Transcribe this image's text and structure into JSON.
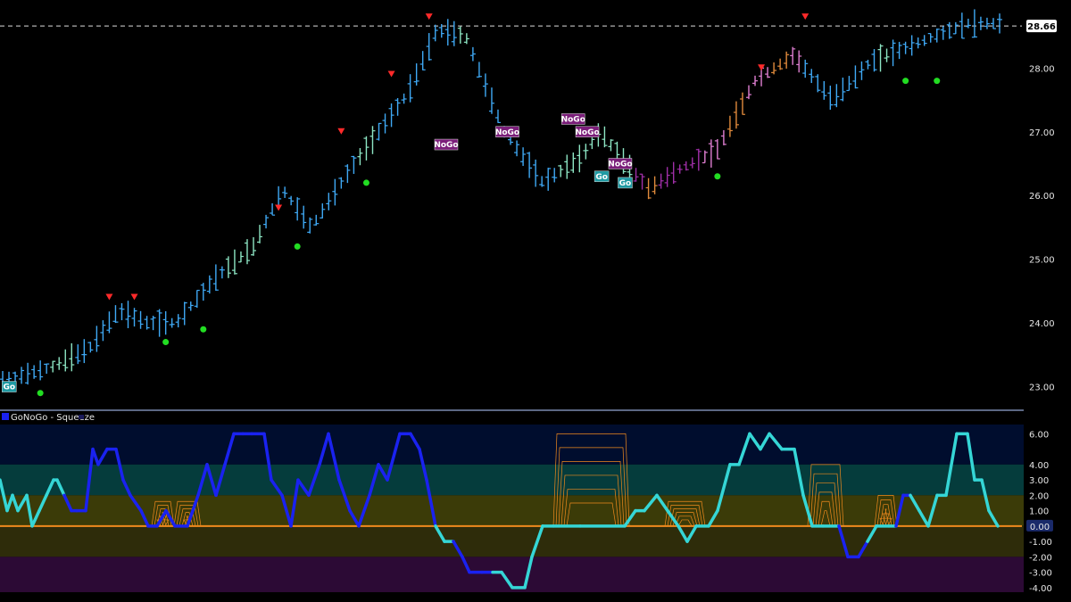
{
  "chart_data": [
    {
      "type": "ohlc",
      "price_axis": {
        "ticks": [
          "28.00",
          "27.00",
          "26.00",
          "25.00",
          "24.00",
          "23.00"
        ],
        "tick_values": [
          28,
          27,
          26,
          25,
          24,
          23
        ],
        "ylim": [
          22.7,
          28.9
        ]
      },
      "last_price_label": "28.66",
      "last_price": 28.66,
      "regime_labels": [
        {
          "text": "Go",
          "bar": 0,
          "price": 23.0
        },
        {
          "text": "NoGo",
          "bar": 92,
          "price": 26.8
        },
        {
          "text": "NoGo",
          "bar": 105,
          "price": 27.0
        },
        {
          "text": "NoGo",
          "bar": 119,
          "price": 27.2
        },
        {
          "text": "NoGo",
          "bar": 122,
          "price": 27.0
        },
        {
          "text": "NoGo",
          "bar": 129,
          "price": 26.5
        },
        {
          "text": "Go",
          "bar": 126,
          "price": 26.3
        },
        {
          "text": "Go",
          "bar": 131,
          "price": 26.2
        }
      ],
      "colors": {
        "strong_go": "#3fa9f5",
        "weak_go": "#8de6c4",
        "weak_nogo": "#e07fd2",
        "strong_nogo": "#a02fa8",
        "amber": "#e08a3c",
        "go_tag": "#1f9aa3",
        "nogo_tag": "#7b1e7a",
        "down_marker": "#ff2a2a",
        "up_marker": "#22dd22"
      }
    },
    {
      "type": "line",
      "title": "GoNoGo - Squeeze",
      "oscillator_axis": {
        "ticks": [
          "6.00",
          "4.00",
          "3.00",
          "2.00",
          "1.00",
          "0.00",
          "-1.00",
          "-2.00",
          "-3.00",
          "-4.00"
        ],
        "tick_values": [
          6,
          4,
          3,
          2,
          1,
          0,
          -1,
          -2,
          -3,
          -4
        ],
        "ylim": [
          -4.3,
          6.6
        ]
      },
      "zero_label": "0.00",
      "colors": {
        "oscillator_go": "#35d6d6",
        "oscillator_strong": "#1a22f0",
        "zero_line": "#f08a1e",
        "band_top": "#000d2e",
        "band_teal": "#053c3c",
        "band_olive": "#3b3b08",
        "band_olive_low": "#2e2c0a",
        "band_purple": "#2c0a35"
      }
    }
  ]
}
